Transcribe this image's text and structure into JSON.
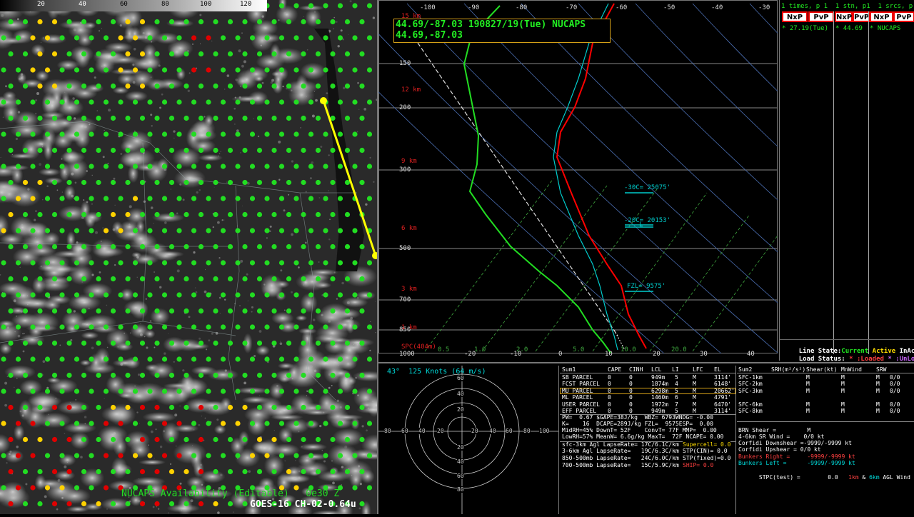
{
  "colorbar": {
    "ticks": [
      "20",
      "40",
      "60",
      "80",
      "100",
      "120"
    ]
  },
  "map": {
    "caption_availability": "NUCAPS Availability (Editable)   0e30 Z",
    "caption_product": "GOES-16 CH-02-0.64u"
  },
  "skewt": {
    "header_line1": "44.69/-87.03 190827/19(Tue) NUCAPS",
    "header_line2": "44.69,-87.03",
    "temp_ticks": [
      "-100",
      "-90",
      "-80",
      "-70",
      "-60",
      "-50",
      "-40",
      "-30"
    ],
    "temp_ticks_bottom": [
      "-20",
      "-10",
      "0",
      "10",
      "20",
      "30",
      "40"
    ],
    "pressure_labels": [
      "150",
      "200",
      "300",
      "500",
      "700",
      "850",
      "1000"
    ],
    "height_labels": [
      "15 km",
      "12 km",
      "9 km",
      "6 km",
      "3 km",
      "1 km"
    ],
    "sfc_label": "SPC(404m)",
    "mixing_ratio_labels": [
      "0.5",
      "1.0",
      "2.0",
      "5.0",
      "10.0",
      "20.0"
    ],
    "level_30c": "-30C= 25075'",
    "level_20c": "-20C= 20153'",
    "level_fzl": "FZL= 9575'",
    "lcl_mark": "L"
  },
  "right_panel": {
    "header_row": "1 times, p 1  1 stn, p1  1 srcs, p 1",
    "buttons": [
      "NxP",
      "PvP",
      "NxP",
      "PvP",
      "NxP",
      "PvP"
    ],
    "entry": {
      "time": "* 27.19(Tue)",
      "station": "* 44.69",
      "source": "* NUCAPS"
    },
    "line_state_label": "Line State:",
    "line_state_current": "Current",
    "line_state_active": "Active",
    "line_state_inactive": "InAct",
    "load_status_label": "Load Status:",
    "load_status_loaded": "* :Loaded",
    "load_status_unloaded": "* :UnLoa"
  },
  "hodograph": {
    "title": "43°  125 Knots (64 m/s)",
    "ring_labels": [
      "80",
      "60",
      "40",
      "20",
      "20",
      "40",
      "60",
      "80",
      "100"
    ],
    "vertical_labels": [
      "60",
      "40",
      "20",
      "20",
      "40",
      "60",
      "80"
    ]
  },
  "parcel_table": {
    "headers": [
      "Sum1",
      "CAPE",
      "CINH",
      "LCL",
      "LI",
      "LFC",
      "EL"
    ],
    "rows": [
      [
        "SB PARCEL",
        "0",
        "0",
        "949m",
        "5",
        "M",
        "3114'"
      ],
      [
        "FCST PARCEL",
        "0",
        "0",
        "1874m",
        "4",
        "M",
        "6148'"
      ],
      [
        "MU PARCEL",
        "0",
        "0",
        "6298m",
        "5",
        "M",
        "20662'"
      ],
      [
        "ML PARCEL",
        "0",
        "0",
        "1460m",
        "6",
        "M",
        "4791'"
      ],
      [
        "USER PARCEL",
        "0",
        "0",
        "1972m",
        "7",
        "M",
        "6470'"
      ],
      [
        "EFF PARCEL",
        "0",
        "0",
        "949m",
        "5",
        "M",
        "3114'"
      ]
    ],
    "indices": [
      "PW=  0.67 $GAPE=38J/kg  WBZ= 6793WNDG= -0.00",
      "K=    16  DCAPE=289J/kg FZL=  9575ESP=  0.00",
      "MidRH=45% DownT= 52F    ConvT= 77F MMP=  0.00",
      "LowRH=57% MeanW= 6.6g/kg MaxT=  72F NCAPE= 0.00"
    ],
    "lapse": [
      "sfc-3km Agl LapseRate= 17C/6.1C/km",
      "3-6km Agl LapseRate=   19C/6.3C/km",
      "850-500mb LapseRate=   24C/6.0C/km",
      "700-500mb LapseRate=   15C/5.9C/km"
    ],
    "severe": [
      "Supercell= 0.0",
      "STP(CIN)= 0.0",
      "STP(fixed)=0.0",
      "SHIP= 0.0"
    ]
  },
  "shear_table": {
    "headers": [
      "Sum2",
      "SRH(m²/s²)",
      "Shear(kt)",
      "MnWind",
      "SRW"
    ],
    "rows": [
      [
        "SFC-1km",
        "M",
        "M",
        "M",
        "0/0"
      ],
      [
        "SFC-2km",
        "M",
        "M",
        "M",
        "0/0"
      ],
      [
        "SFC-3km",
        "M",
        "M",
        "M",
        "0/0"
      ],
      [
        "",
        "",
        " ",
        "",
        ""
      ],
      [
        "SFC-6km",
        "M",
        "M",
        "M",
        "0/0"
      ],
      [
        "SFC-8km",
        "M",
        "M",
        "M",
        "0/0"
      ]
    ],
    "brn": "BRN Shear =         M",
    "sr46": "4-6km SR Wind =    0/0 kt",
    "corfidi_down": "Corfidi Downshear =-9999/-9999 kt",
    "corfidi_up": "Corfidi Upshear = 0/0 kt",
    "bunkers_right": "Bunkers Right =     -9999/-9999 kt",
    "bunkers_left": "Bunkers Left =      -9999/-9999 kt",
    "stpc": "STPC(test) =        0.0",
    "stpc_1km": "1km",
    "stpc_and": "&",
    "stpc_6km": "6km",
    "stpc_tail": "AGL Wind"
  }
}
